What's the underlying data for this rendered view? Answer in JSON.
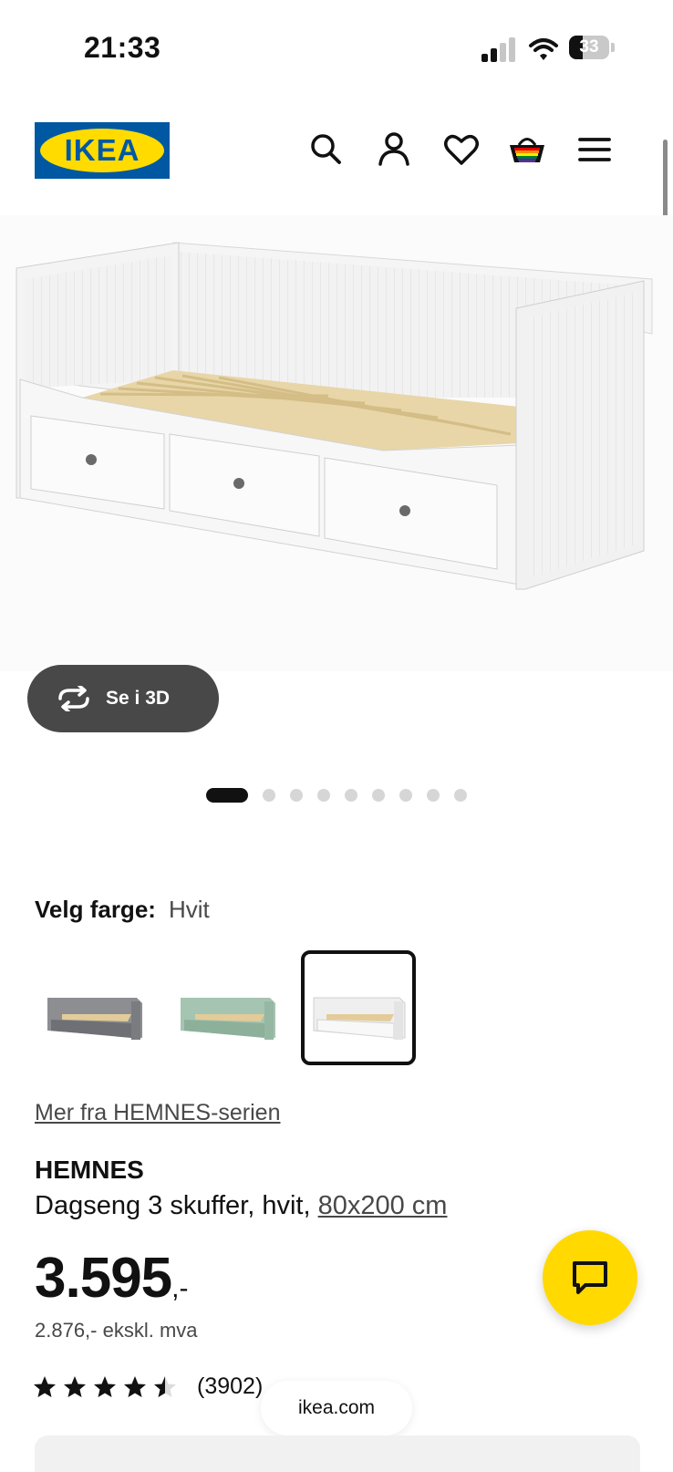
{
  "status_bar": {
    "time": "21:33",
    "battery_level": "33",
    "battery_fraction": 0.33
  },
  "header": {
    "logo_text": "IKEA",
    "icons": [
      "search-icon",
      "account-icon",
      "heart-icon",
      "basket-icon",
      "menu-icon"
    ]
  },
  "media": {
    "view_3d_label": "Se i 3D",
    "carousel_total": 9,
    "carousel_active": 1
  },
  "color_picker": {
    "label": "Velg farge:",
    "selected": "Hvit",
    "options": [
      "Grå",
      "Grønn",
      "Hvit"
    ]
  },
  "product": {
    "series_link": "Mer fra HEMNES-serien",
    "name": "HEMNES",
    "description": "Dagseng 3 skuffer, hvit,",
    "size_link": "80x200 cm",
    "price": "3.595",
    "price_suffix": ",-",
    "price_ex_vat": "2.876,- ekskl. mva",
    "rating_value": 4.5,
    "rating_count": "(3902)"
  },
  "browser": {
    "url": "ikea.com"
  },
  "colors": {
    "ikea_blue": "#0058a3",
    "ikea_yellow": "#ffdb00",
    "chat_yellow": "#ffd900"
  }
}
